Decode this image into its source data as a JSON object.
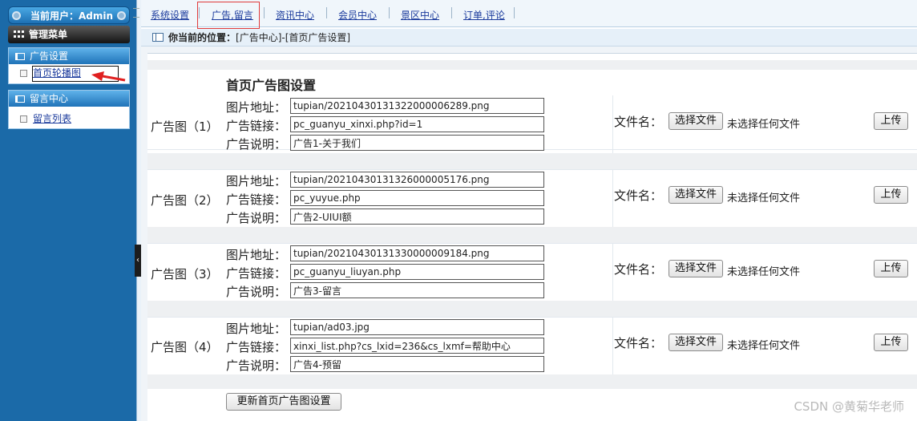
{
  "sidebar": {
    "user_label": "当前用户：Admin",
    "menu_title": "管理菜单",
    "sections": [
      {
        "title": "广告设置",
        "items": [
          "首页轮播图"
        ]
      },
      {
        "title": "留言中心",
        "items": [
          "留言列表"
        ]
      }
    ]
  },
  "topnav": {
    "items": [
      "系统设置",
      "广告,留言",
      "资讯中心",
      "会员中心",
      "景区中心",
      "订单,评论"
    ],
    "active": "广告,留言"
  },
  "breadcrumb": {
    "prefix": "你当前的位置：",
    "path": "[广告中心]-[首页广告设置]"
  },
  "form": {
    "title": "首页广告图设置",
    "field_labels": {
      "image": "图片地址：",
      "link": "广告链接：",
      "desc": "广告说明："
    },
    "file_label": "文件名：",
    "choose_button": "选择文件",
    "no_file_text": "未选择任何文件",
    "upload_button": "上传",
    "submit_button": "更新首页广告图设置",
    "ads": [
      {
        "label": "广告图（1）",
        "image": "tupian/20210430131322000006289.png",
        "link": "pc_guanyu_xinxi.php?id=1",
        "desc": "广告1-关于我们"
      },
      {
        "label": "广告图（2）",
        "image": "tupian/20210430131326000005176.png",
        "link": "pc_yuyue.php",
        "desc": "广告2-UIUI额"
      },
      {
        "label": "广告图（3）",
        "image": "tupian/20210430131330000009184.png",
        "link": "pc_guanyu_liuyan.php",
        "desc": "广告3-留言"
      },
      {
        "label": "广告图（4）",
        "image": "tupian/ad03.jpg",
        "link": "xinxi_list.php?cs_lxid=236&cs_lxmf=帮助中心",
        "desc": "广告4-预留"
      }
    ]
  },
  "watermark": "CSDN @黄菊华老师",
  "colors": {
    "sidebar_bg": "#1b6aa8",
    "section_head": "#1f73b8",
    "active_nav_border": "#e03a3a",
    "arrow": "#e02020"
  }
}
